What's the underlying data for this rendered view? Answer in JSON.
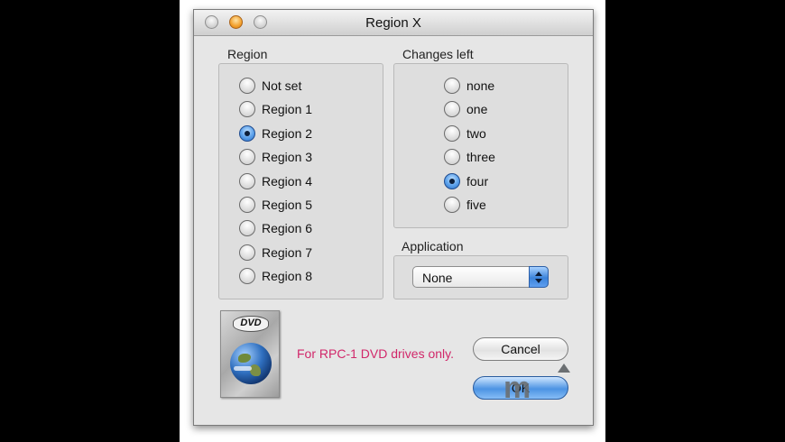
{
  "window": {
    "title": "Region X",
    "controls": [
      "close-button",
      "minimize-button",
      "zoom-button"
    ]
  },
  "region": {
    "label": "Region",
    "options": [
      "Not set",
      "Region 1",
      "Region 2",
      "Region 3",
      "Region 4",
      "Region 5",
      "Region 6",
      "Region 7",
      "Region 8"
    ],
    "selected": "Region 2"
  },
  "changes_left": {
    "label": "Changes left",
    "options": [
      "none",
      "one",
      "two",
      "three",
      "four",
      "five"
    ],
    "selected": "four"
  },
  "application": {
    "label": "Application",
    "value": "None"
  },
  "dvd_logo": {
    "text": "DVD",
    "icon": "dvd-globe-icon"
  },
  "note": "For RPC-1 DVD drives only.",
  "buttons": {
    "cancel": "Cancel",
    "ok": "OK"
  },
  "colors": {
    "note": "#d1286a",
    "accent": "#3b83da"
  }
}
